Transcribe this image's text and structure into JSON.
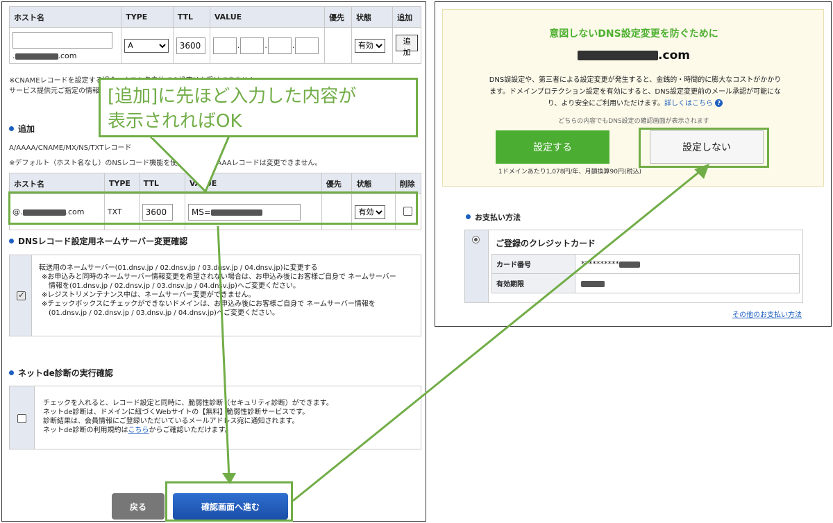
{
  "top_table": {
    "headers": [
      "ホスト名",
      "TYPE",
      "TTL",
      "VALUE",
      "優先",
      "状態",
      "追加"
    ],
    "domain_suffix": ".com",
    "prefix": ".",
    "type_value": "A",
    "ttl_value": "3600",
    "value_dots": [
      ".",
      ".",
      "."
    ],
    "status_value": "有効",
    "add_button": "追加"
  },
  "cname_note": {
    "line1": "※CNAMEレコードを設定する場合、ホスト名自体での設定はお受けできません。",
    "line2": "サービス提供元ご指定の情報"
  },
  "add_section": {
    "title": "追加",
    "record_types": "A/AAAA/CNAME/MX/NS/TXTレコード",
    "default_note": "※デフォルト（ホスト名なし）のNSレコード機能を使用中は、A/AAAAレコードは変更できません。",
    "headers": [
      "ホスト名",
      "TYPE",
      "TTL",
      "VALUE",
      "優先",
      "状態",
      "削除"
    ],
    "row": {
      "host_prefix": "@.",
      "host_suffix": ".com",
      "type": "TXT",
      "ttl": "3600",
      "value_prefix": "MS=",
      "status": "有効"
    }
  },
  "ns_section": {
    "title": "DNSレコード設定用ネームサーバー変更確認",
    "lines": [
      "転送用のネームサーバー(01.dnsv.jp / 02.dnsv.jp / 03.dnsv.jp / 04.dnsv.jp)に変更する",
      "※お申込みと同時のネームサーバー情報変更を希望されない場合は、お申込み後にお客様ご自身で ネームサーバー",
      "情報を(01.dnsv.jp / 02.dnsv.jp / 03.dnsv.jp / 04.dnsv.jp)へご変更ください。",
      "※レジストリメンテナンス中は、ネームサーバー変更ができません。",
      "※チェックボックスにチェックができないドメインは、お申込み後にお客様ご自身で ネームサーバー情報を",
      "(01.dnsv.jp / 02.dnsv.jp / 03.dnsv.jp / 04.dnsv.jp)へご変更ください。"
    ]
  },
  "netde_section": {
    "title": "ネットde診断の実行確認",
    "lines": [
      "チェックを入れると、レコード設定と同時に、脆弱性診断（セキュリティ診断）ができます。",
      "ネットde診断は、ドメインに紐づくWebサイトの【無料】脆弱性診断サービスです。",
      "診断結果は、会員情報にご登録いただいているメールアドレス宛に通知されます。"
    ],
    "terms_prefix": "ネットde診断の利用規約は",
    "terms_link": "こちら",
    "terms_suffix": "からご確認いただけます。"
  },
  "buttons": {
    "back": "戻る",
    "confirm": "確認画面へ進む"
  },
  "callout": {
    "text": "[追加]に先ほど入力した内容が\n表示されればOK"
  },
  "promo": {
    "title": "意図しないDNS設定変更を防ぐために",
    "domain_suffix": ".com",
    "desc_line1": "DNS誤設定や、第三者による設定変更が発生すると、金銭的・時間的に膨大なコストがかかり",
    "desc_line2": "ます。ドメインプロテクション設定を有効にすると、DNS設定変更前のメール承認が可能にな",
    "desc_line3": "り、より安全にご利用いただけます。",
    "details_link": "詳しくはこちら",
    "sub_note": "どちらの内容でもDNS設定の確認画面が表示されます",
    "enable_button": "設定する",
    "disable_button": "設定しない",
    "price_note": "1ドメインあたり1,078円/年、月額換算90円(税込)"
  },
  "payment": {
    "title": "お支払い方法",
    "card_title": "ご登録のクレジットカード",
    "card_number_label": "カード番号",
    "card_number_value": "**********",
    "expiry_label": "有効期限",
    "other_link": "その他のお支払い方法"
  },
  "colors": {
    "highlight_green": "#71ad47",
    "promo_green": "#4cad33",
    "header_bg": "#e4e8f0",
    "confirm_blue": "#1a4ea8",
    "link_blue": "#1d5fbf"
  }
}
